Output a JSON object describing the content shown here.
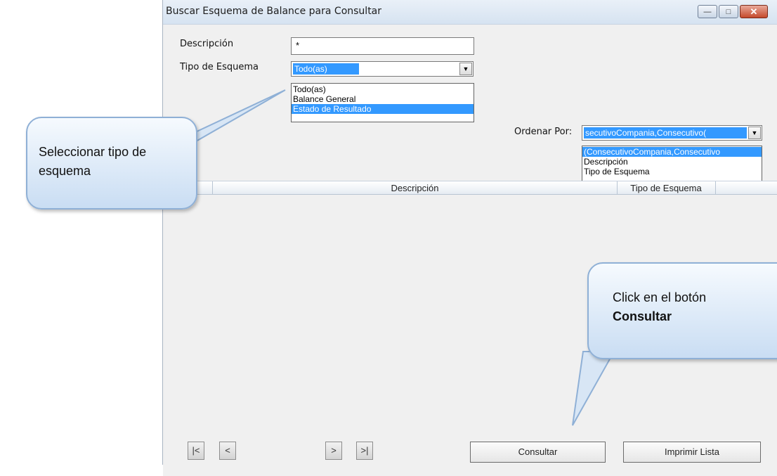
{
  "window": {
    "title": "Buscar Esquema de Balance para Consultar",
    "controls": {
      "minimize": "—",
      "maximize": "□",
      "close": "✕"
    }
  },
  "form": {
    "descripcion_label": "Descripción",
    "descripcion_value": "*",
    "tipo_label": "Tipo de Esquema",
    "tipo_value": "Todo(as)",
    "tipo_options": [
      "Todo(as)",
      "Balance General",
      "Estado de Resultado"
    ],
    "ordenar_label": "Ordenar Por:",
    "ordenar_value": "secutivoCompania,Consecutivo(",
    "ordenar_options": [
      "(ConsecutivoCompania,Consecutivo",
      "Descripción",
      "Tipo de Esquema"
    ]
  },
  "grid": {
    "columns": [
      "Descripción",
      "Tipo de Esquema"
    ]
  },
  "nav": {
    "first": "|<",
    "prev": "<",
    "next": ">",
    "last": ">|"
  },
  "actions": {
    "consultar": "Consultar",
    "imprimir": "Imprimir Lista"
  },
  "callouts": {
    "tipo_line1": "Seleccionar tipo de",
    "tipo_line2": "esquema",
    "consultar_line1": "Click en el botón",
    "consultar_line2": "Consultar"
  },
  "colors": {
    "selection": "#3399ff",
    "callout_border": "#8fb0d6"
  }
}
